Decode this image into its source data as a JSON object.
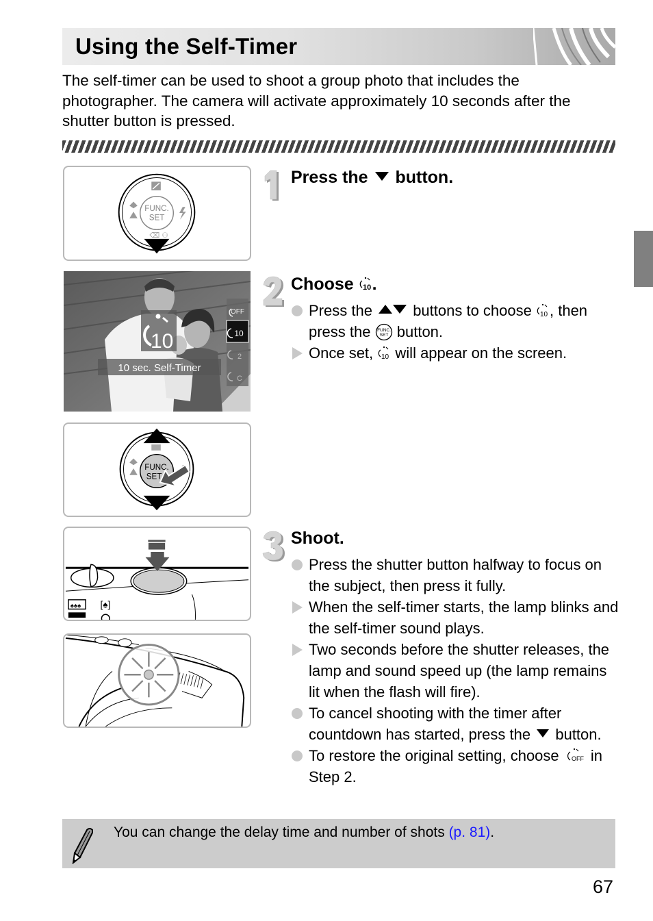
{
  "header": {
    "title": "Using the Self-Timer"
  },
  "intro": "The self-timer can be used to shoot a group photo that includes the photographer. The camera will activate approximately 10 seconds after the shutter button is pressed.",
  "steps": [
    {
      "number": "1",
      "title_before": "Press the",
      "title_icon": "down-arrow-icon",
      "title_after": "button.",
      "bullets": []
    },
    {
      "number": "2",
      "title_before": "Choose",
      "title_icon": "self-timer-10-icon",
      "title_after": ".",
      "bullets": [
        {
          "type": "action",
          "parts": [
            "Press the",
            "buttons to choose",
            ", then press the",
            "button."
          ]
        },
        {
          "type": "result",
          "parts": [
            "Once set,",
            "will appear on the screen."
          ]
        }
      ]
    },
    {
      "number": "3",
      "title": "Shoot.",
      "bullets": [
        {
          "type": "action",
          "text": "Press the shutter button halfway to focus on the subject, then press it fully."
        },
        {
          "type": "result",
          "text": "When the self-timer starts, the lamp blinks and the self-timer sound plays."
        },
        {
          "type": "result",
          "text": "Two seconds before the shutter releases, the lamp and sound speed up (the lamp remains lit when the flash will fire)."
        },
        {
          "type": "action",
          "parts": [
            "To cancel shooting with the timer after countdown has started, press the",
            "button."
          ]
        },
        {
          "type": "action",
          "parts": [
            "To restore the original setting, choose",
            "in Step 2."
          ]
        }
      ]
    }
  ],
  "figures": {
    "control_dial": {
      "center_label_1": "FUNC.",
      "center_label_2": "SET"
    },
    "screen_photo": {
      "banner_text": "10 sec. Self-Timer",
      "big_icon_value": "10",
      "menu_options": [
        {
          "icon": "self-timer-off-icon",
          "label": "OFF",
          "selected": false
        },
        {
          "icon": "self-timer-10-icon",
          "label": "10",
          "selected": true
        },
        {
          "icon": "self-timer-2-icon",
          "label": "2",
          "selected": false
        },
        {
          "icon": "self-timer-custom-icon",
          "label": "C",
          "selected": false
        }
      ]
    }
  },
  "note": {
    "text": "You can change the delay time and number of shots",
    "link_text": "(p. 81)",
    "after": "."
  },
  "page_number": "67"
}
